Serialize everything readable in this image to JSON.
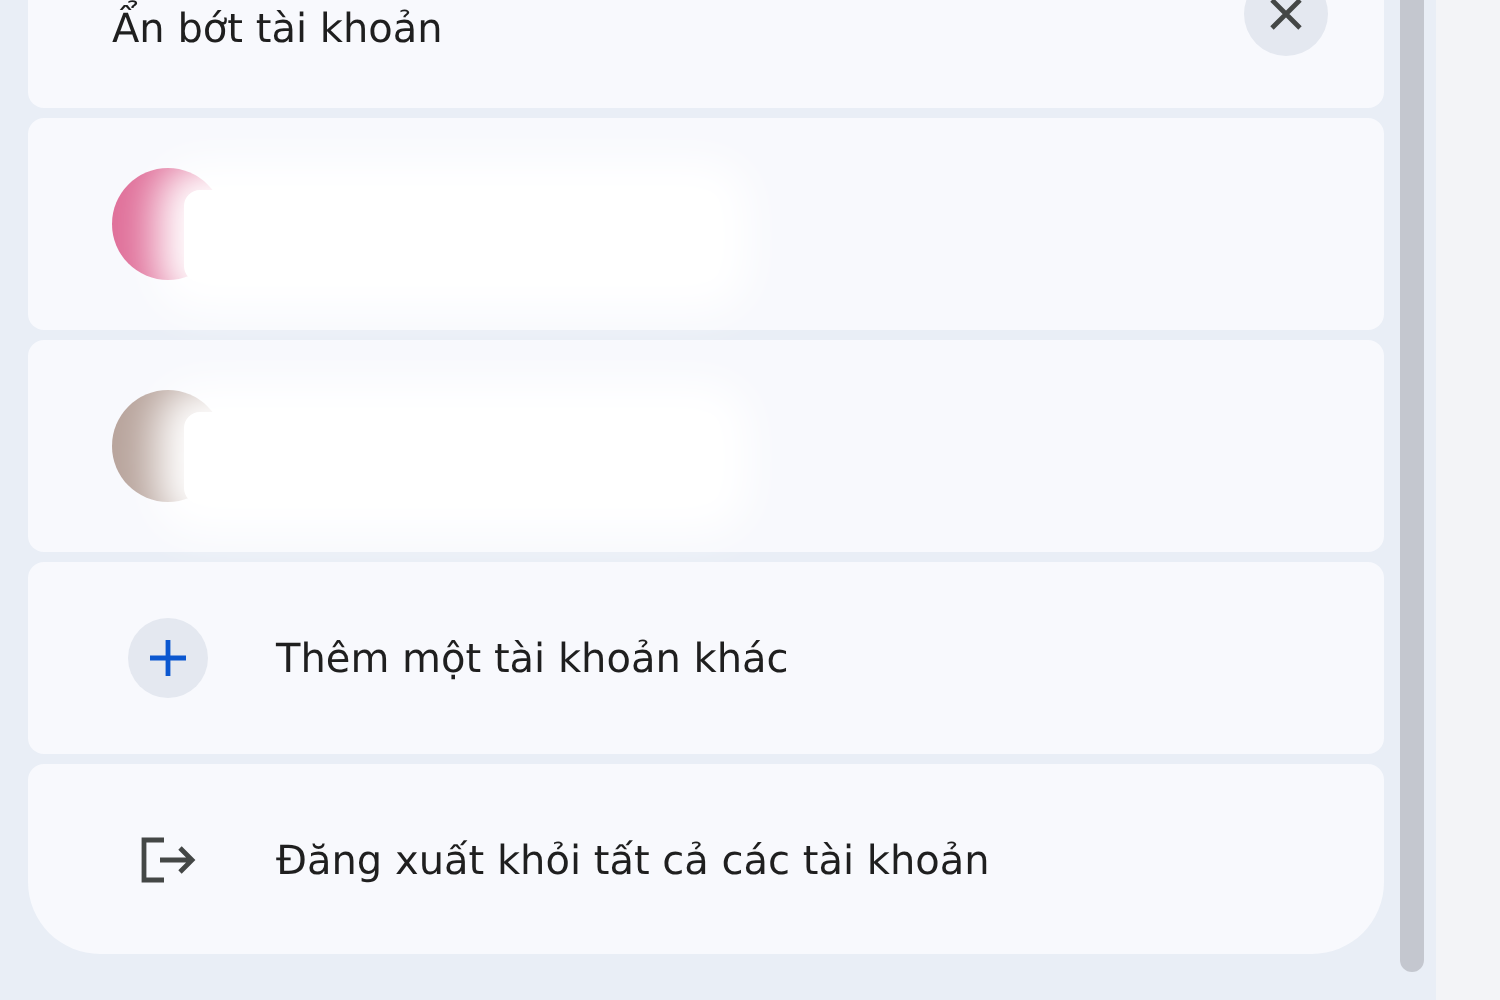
{
  "header": {
    "title": "Ẩn bớt tài khoản"
  },
  "accounts": [
    {
      "color": "#e0709a"
    },
    {
      "color": "#b8a49c"
    }
  ],
  "actions": [
    {
      "kind": "add",
      "label": "Thêm một tài khoản khác"
    },
    {
      "kind": "logout",
      "label": "Đăng xuất khỏi tất cả các tài khoản"
    }
  ]
}
